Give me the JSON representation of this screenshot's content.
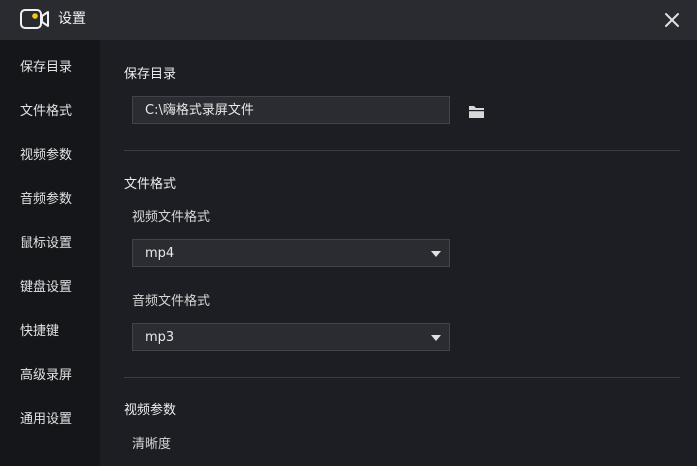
{
  "window": {
    "title": "设置"
  },
  "sidebar": {
    "items": [
      {
        "label": "保存目录"
      },
      {
        "label": "文件格式"
      },
      {
        "label": "视频参数"
      },
      {
        "label": "音频参数"
      },
      {
        "label": "鼠标设置"
      },
      {
        "label": "键盘设置"
      },
      {
        "label": "快捷键"
      },
      {
        "label": "高级录屏"
      },
      {
        "label": "通用设置"
      }
    ]
  },
  "save_dir": {
    "title": "保存目录",
    "path": "C:\\嗨格式录屏文件"
  },
  "file_format": {
    "title": "文件格式",
    "video_label": "视频文件格式",
    "video_value": "mp4",
    "audio_label": "音频文件格式",
    "audio_value": "mp3"
  },
  "video_params": {
    "title": "视频参数",
    "clarity_label": "清晰度"
  },
  "icons": {
    "app": "video-camera-icon",
    "close": "close-icon",
    "folder": "folder-icon",
    "dropdown": "chevron-down-icon"
  },
  "colors": {
    "accent": "#f5c518",
    "background": "#1d1e23",
    "sidebar": "#15161a",
    "titlebar": "#2a2b31"
  }
}
